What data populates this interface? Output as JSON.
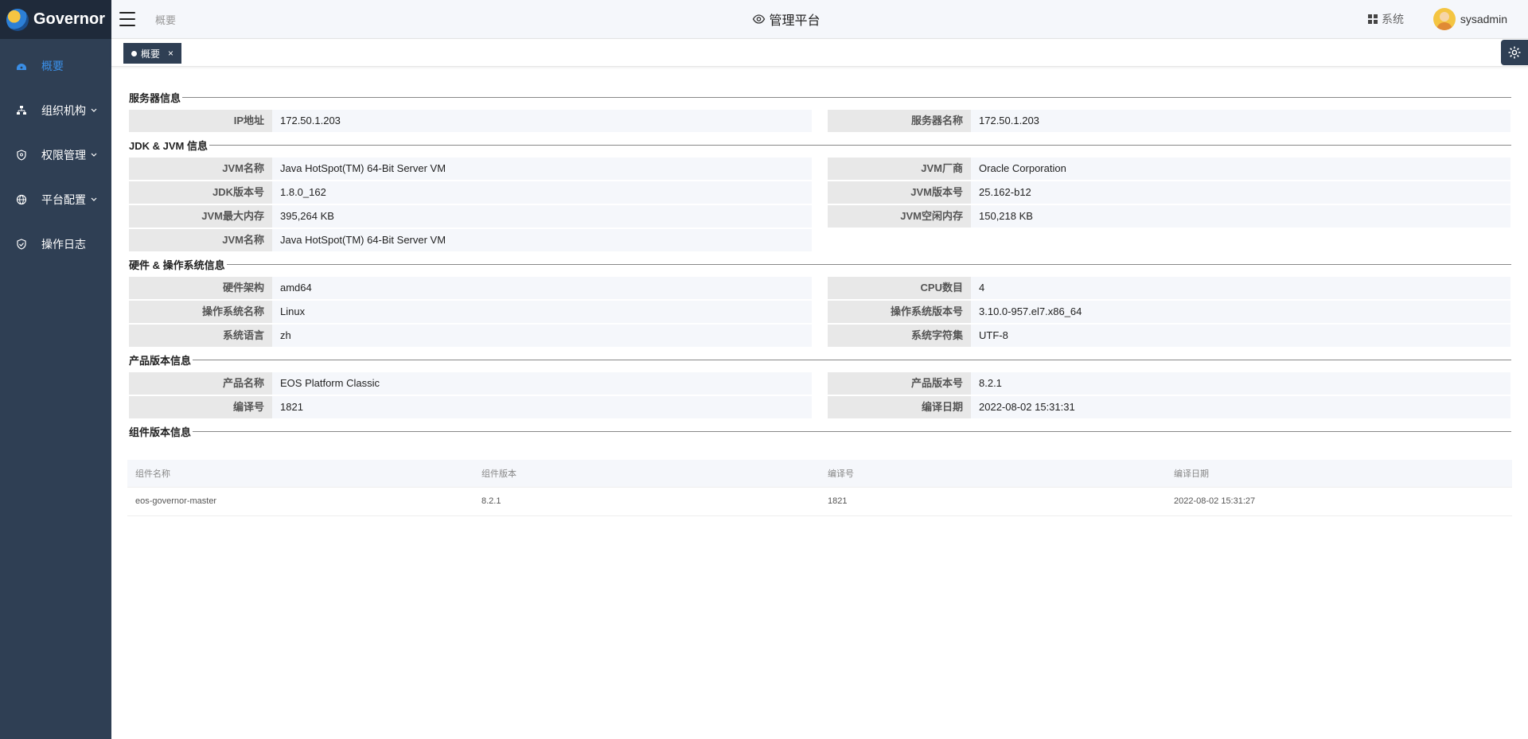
{
  "app": {
    "name": "Governor"
  },
  "sidebar": {
    "items": [
      {
        "label": "概要",
        "icon": "dashboard-icon",
        "active": true,
        "expandable": false
      },
      {
        "label": "组织机构",
        "icon": "org-chart-icon",
        "active": false,
        "expandable": true
      },
      {
        "label": "权限管理",
        "icon": "shield-icon",
        "active": false,
        "expandable": true
      },
      {
        "label": "平台配置",
        "icon": "globe-icon",
        "active": false,
        "expandable": true
      },
      {
        "label": "操作日志",
        "icon": "shield-check-icon",
        "active": false,
        "expandable": false
      }
    ]
  },
  "header": {
    "breadcrumb": "概要",
    "title": "管理平台",
    "system_label": "系统",
    "username": "sysadmin"
  },
  "tabs": [
    {
      "label": "概要",
      "close": "×"
    }
  ],
  "sections": {
    "server": {
      "title": "服务器信息",
      "rows": [
        {
          "k": "IP地址",
          "v": "172.50.1.203"
        },
        {
          "k": "服务器名称",
          "v": "172.50.1.203"
        }
      ]
    },
    "jvm": {
      "title": "JDK & JVM 信息",
      "rows": [
        {
          "k": "JVM名称",
          "v": "Java HotSpot(TM) 64-Bit Server VM"
        },
        {
          "k": "JVM厂商",
          "v": "Oracle Corporation"
        },
        {
          "k": "JDK版本号",
          "v": "1.8.0_162"
        },
        {
          "k": "JVM版本号",
          "v": "25.162-b12"
        },
        {
          "k": "JVM最大内存",
          "v": "395,264 KB"
        },
        {
          "k": "JVM空闲内存",
          "v": "150,218 KB"
        },
        {
          "k": "JVM名称",
          "v": "Java HotSpot(TM) 64-Bit Server VM"
        }
      ]
    },
    "hardware": {
      "title": "硬件 & 操作系统信息",
      "rows": [
        {
          "k": "硬件架构",
          "v": "amd64"
        },
        {
          "k": "CPU数目",
          "v": "4"
        },
        {
          "k": "操作系统名称",
          "v": "Linux"
        },
        {
          "k": "操作系统版本号",
          "v": "3.10.0-957.el7.x86_64"
        },
        {
          "k": "系统语言",
          "v": "zh"
        },
        {
          "k": "系统字符集",
          "v": "UTF-8"
        }
      ]
    },
    "product": {
      "title": "产品版本信息",
      "rows": [
        {
          "k": "产品名称",
          "v": "EOS Platform Classic"
        },
        {
          "k": "产品版本号",
          "v": "8.2.1"
        },
        {
          "k": "编译号",
          "v": "1821"
        },
        {
          "k": "编译日期",
          "v": "2022-08-02 15:31:31"
        }
      ]
    },
    "components": {
      "title": "组件版本信息",
      "columns": [
        "组件名称",
        "组件版本",
        "编译号",
        "编译日期"
      ],
      "rows": [
        [
          "eos-governor-master",
          "8.2.1",
          "1821",
          "2022-08-02 15:31:27"
        ]
      ]
    }
  },
  "colors": {
    "sidebar_bg": "#2f3f54",
    "accent": "#3a8ee6"
  }
}
